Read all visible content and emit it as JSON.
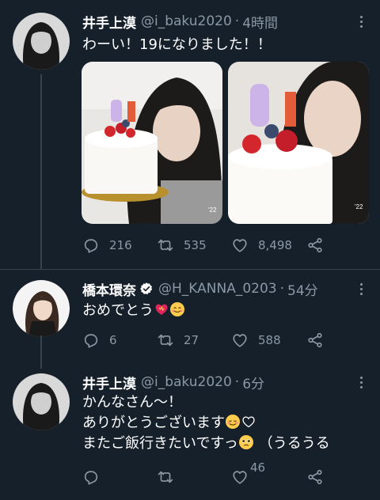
{
  "tweets": [
    {
      "name": "井手上漠",
      "handle": "@i_baku2020",
      "time": "4時間",
      "lines": [
        "わーい！19になりました！！"
      ],
      "actions": {
        "reply": "216",
        "retweet": "535",
        "like": "8,498"
      }
    },
    {
      "name": "橋本環奈",
      "handle": "@H_KANNA_0203",
      "time": "54分",
      "lines": [
        "おめでとう"
      ],
      "actions": {
        "reply": "6",
        "retweet": "27",
        "like": "588"
      }
    },
    {
      "name": "井手上漠",
      "handle": "@i_baku2020",
      "time": "6分",
      "lines": [
        "かんなさん〜！",
        "ありがとうございます",
        "またご飯行きたいですっ",
        "（うるうる"
      ],
      "actions": {
        "reply": "",
        "retweet": "",
        "like": "46"
      }
    }
  ],
  "photos": {
    "watermark": "'22"
  },
  "icons": [
    "reply-icon",
    "retweet-icon",
    "like-icon",
    "share-icon",
    "more-icon",
    "verified-icon"
  ],
  "colors": {
    "background": "#15202b",
    "secondary_text": "#8b98a5",
    "divider": "#38444d",
    "verified": "#ffffff"
  }
}
